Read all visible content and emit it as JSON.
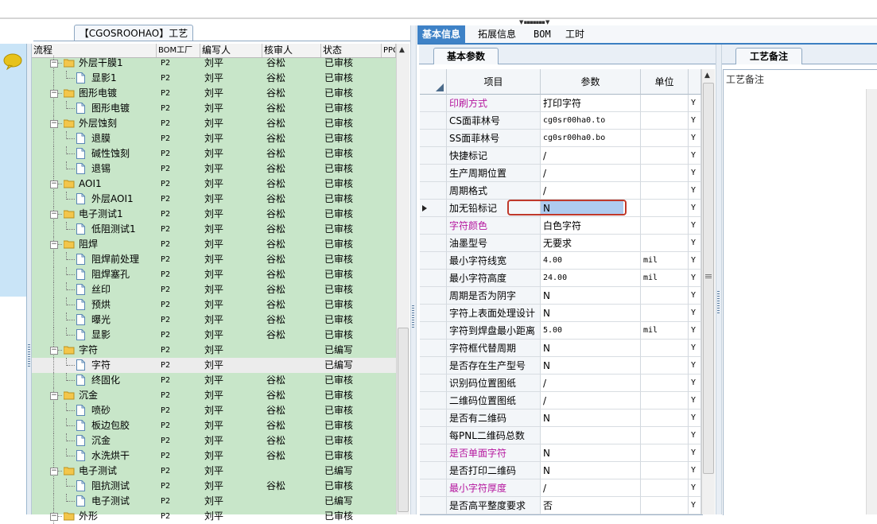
{
  "group_title": "【CGOSROOHAO】工艺流程",
  "tree": {
    "columns": [
      "流程",
      "BOM工厂",
      "编写人",
      "核审人",
      "状态",
      "PPC"
    ],
    "rows": [
      {
        "name": "外层干膜1",
        "folder": true,
        "bom": "P2",
        "writer": "刘平",
        "reviewer": "谷松",
        "status": "已审核"
      },
      {
        "name": "显影1",
        "folder": false,
        "bom": "P2",
        "writer": "刘平",
        "reviewer": "谷松",
        "status": "已审核"
      },
      {
        "name": "图形电镀",
        "folder": true,
        "bom": "P2",
        "writer": "刘平",
        "reviewer": "谷松",
        "status": "已审核"
      },
      {
        "name": "图形电镀",
        "folder": false,
        "bom": "P2",
        "writer": "刘平",
        "reviewer": "谷松",
        "status": "已审核"
      },
      {
        "name": "外层蚀刻",
        "folder": true,
        "bom": "P2",
        "writer": "刘平",
        "reviewer": "谷松",
        "status": "已审核"
      },
      {
        "name": "退膜",
        "folder": false,
        "bom": "P2",
        "writer": "刘平",
        "reviewer": "谷松",
        "status": "已审核"
      },
      {
        "name": "碱性蚀刻",
        "folder": false,
        "bom": "P2",
        "writer": "刘平",
        "reviewer": "谷松",
        "status": "已审核"
      },
      {
        "name": "退锡",
        "folder": false,
        "bom": "P2",
        "writer": "刘平",
        "reviewer": "谷松",
        "status": "已审核"
      },
      {
        "name": "AOI1",
        "folder": true,
        "bom": "P2",
        "writer": "刘平",
        "reviewer": "谷松",
        "status": "已审核"
      },
      {
        "name": "外层AOI1",
        "folder": false,
        "bom": "P2",
        "writer": "刘平",
        "reviewer": "谷松",
        "status": "已审核"
      },
      {
        "name": "电子测试1",
        "folder": true,
        "bom": "P2",
        "writer": "刘平",
        "reviewer": "谷松",
        "status": "已审核"
      },
      {
        "name": "低阻测试1",
        "folder": false,
        "bom": "P2",
        "writer": "刘平",
        "reviewer": "谷松",
        "status": "已审核"
      },
      {
        "name": "阻焊",
        "folder": true,
        "bom": "P2",
        "writer": "刘平",
        "reviewer": "谷松",
        "status": "已审核"
      },
      {
        "name": "阻焊前处理",
        "folder": false,
        "bom": "P2",
        "writer": "刘平",
        "reviewer": "谷松",
        "status": "已审核"
      },
      {
        "name": "阻焊塞孔",
        "folder": false,
        "bom": "P2",
        "writer": "刘平",
        "reviewer": "谷松",
        "status": "已审核"
      },
      {
        "name": "丝印",
        "folder": false,
        "bom": "P2",
        "writer": "刘平",
        "reviewer": "谷松",
        "status": "已审核"
      },
      {
        "name": "预烘",
        "folder": false,
        "bom": "P2",
        "writer": "刘平",
        "reviewer": "谷松",
        "status": "已审核"
      },
      {
        "name": "曝光",
        "folder": false,
        "bom": "P2",
        "writer": "刘平",
        "reviewer": "谷松",
        "status": "已审核"
      },
      {
        "name": "显影",
        "folder": false,
        "bom": "P2",
        "writer": "刘平",
        "reviewer": "谷松",
        "status": "已审核"
      },
      {
        "name": "字符",
        "folder": true,
        "bom": "P2",
        "writer": "刘平",
        "reviewer": "",
        "status": "已编写"
      },
      {
        "name": "字符",
        "folder": false,
        "bom": "P2",
        "writer": "刘平",
        "reviewer": "",
        "status": "已编写",
        "selected": true
      },
      {
        "name": "终固化",
        "folder": false,
        "bom": "P2",
        "writer": "刘平",
        "reviewer": "谷松",
        "status": "已审核"
      },
      {
        "name": "沉金",
        "folder": true,
        "bom": "P2",
        "writer": "刘平",
        "reviewer": "谷松",
        "status": "已审核"
      },
      {
        "name": "喷砂",
        "folder": false,
        "bom": "P2",
        "writer": "刘平",
        "reviewer": "谷松",
        "status": "已审核"
      },
      {
        "name": "板边包胶",
        "folder": false,
        "bom": "P2",
        "writer": "刘平",
        "reviewer": "谷松",
        "status": "已审核"
      },
      {
        "name": "沉金",
        "folder": false,
        "bom": "P2",
        "writer": "刘平",
        "reviewer": "谷松",
        "status": "已审核"
      },
      {
        "name": "水洗烘干",
        "folder": false,
        "bom": "P2",
        "writer": "刘平",
        "reviewer": "谷松",
        "status": "已审核"
      },
      {
        "name": "电子测试",
        "folder": true,
        "bom": "P2",
        "writer": "刘平",
        "reviewer": "",
        "status": "已编写"
      },
      {
        "name": "阻抗测试",
        "folder": false,
        "bom": "P2",
        "writer": "刘平",
        "reviewer": "谷松",
        "status": "已审核"
      },
      {
        "name": "电子测试",
        "folder": false,
        "bom": "P2",
        "writer": "刘平",
        "reviewer": "",
        "status": "已编写"
      },
      {
        "name": "外形",
        "folder": true,
        "bom": "P2",
        "writer": "刘平",
        "reviewer": "",
        "status": "已审核"
      }
    ]
  },
  "main_tabs": [
    "基本信息",
    "拓展信息",
    "BOM",
    "工时"
  ],
  "sub_tab": "基本参数",
  "params": {
    "columns": [
      "项目",
      "参数",
      "单位"
    ],
    "rows": [
      {
        "item": "印刷方式",
        "value": "打印字符",
        "unit": "",
        "flag": "Y",
        "magenta": true
      },
      {
        "item": "CS面菲林号",
        "value": "cg0sr00ha0.to",
        "unit": "",
        "flag": "Y",
        "small": true
      },
      {
        "item": "SS面菲林号",
        "value": "cg0sr00ha0.bo",
        "unit": "",
        "flag": "Y",
        "small": true
      },
      {
        "item": "快捷标记",
        "value": "/",
        "unit": "",
        "flag": "Y"
      },
      {
        "item": "生产周期位置",
        "value": "/",
        "unit": "",
        "flag": "Y"
      },
      {
        "item": "周期格式",
        "value": "/",
        "unit": "",
        "flag": "Y"
      },
      {
        "item": "加无铅标记",
        "value": "N",
        "unit": "",
        "flag": "Y",
        "current": true
      },
      {
        "item": "字符颜色",
        "value": "白色字符",
        "unit": "",
        "flag": "Y",
        "magenta": true
      },
      {
        "item": "油墨型号",
        "value": "无要求",
        "unit": "",
        "flag": "Y"
      },
      {
        "item": "最小字符线宽",
        "value": "4.00",
        "unit": "mil",
        "flag": "Y",
        "small": true
      },
      {
        "item": "最小字符高度",
        "value": "24.00",
        "unit": "mil",
        "flag": "Y",
        "small": true
      },
      {
        "item": "周期是否为阴字",
        "value": "N",
        "unit": "",
        "flag": "Y"
      },
      {
        "item": "字符上表面处理设计",
        "value": "N",
        "unit": "",
        "flag": "Y"
      },
      {
        "item": "字符到焊盘最小距离",
        "value": "5.00",
        "unit": "mil",
        "flag": "Y",
        "small": true
      },
      {
        "item": "字符框代替周期",
        "value": "N",
        "unit": "",
        "flag": "Y"
      },
      {
        "item": "是否存在生产型号",
        "value": "N",
        "unit": "",
        "flag": "Y"
      },
      {
        "item": "识别码位置图纸",
        "value": "/",
        "unit": "",
        "flag": "Y"
      },
      {
        "item": "二维码位置图纸",
        "value": "/",
        "unit": "",
        "flag": "Y"
      },
      {
        "item": "是否有二维码",
        "value": "N",
        "unit": "",
        "flag": "Y"
      },
      {
        "item": "每PNL二维码总数",
        "value": "",
        "unit": "",
        "flag": "Y"
      },
      {
        "item": "是否单面字符",
        "value": "N",
        "unit": "",
        "flag": "Y",
        "magenta": true
      },
      {
        "item": "是否打印二维码",
        "value": "N",
        "unit": "",
        "flag": "Y"
      },
      {
        "item": "最小字符厚度",
        "value": "/",
        "unit": "",
        "flag": "Y",
        "magenta": true
      },
      {
        "item": "是否高平整度要求",
        "value": "否",
        "unit": "",
        "flag": "Y"
      }
    ]
  },
  "notes": {
    "tab": "工艺备注",
    "label": "工艺备注"
  },
  "icons": {
    "chat": "chat-bubble-icon",
    "folder": "folder-icon",
    "document": "document-icon"
  },
  "colors": {
    "tree_bg": "#c8e6c9",
    "accent": "#3e82c7",
    "magenta": "#b5179e",
    "highlight_border": "#c0392b"
  }
}
